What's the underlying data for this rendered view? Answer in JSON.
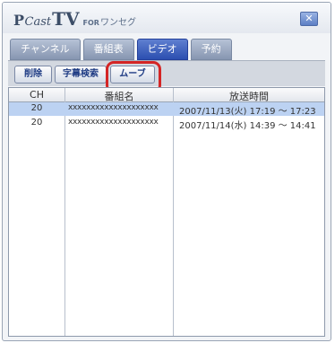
{
  "app": {
    "logo_p": "P",
    "logo_cast": "Cast",
    "logo_tv": "TV",
    "logo_for": "FOR",
    "logo_sub": "ワンセグ"
  },
  "window_buttons": {
    "close_icon": "close-icon",
    "close_glyph": "✕"
  },
  "tabs": [
    {
      "label": "チャンネル",
      "active": false
    },
    {
      "label": "番組表",
      "active": false
    },
    {
      "label": "ビデオ",
      "active": true
    },
    {
      "label": "予約",
      "active": false
    }
  ],
  "toolbar": {
    "delete_label": "削除",
    "subtitle_search_label": "字幕検索",
    "move_label": "ムーブ"
  },
  "table": {
    "headers": {
      "ch": "CH",
      "name": "番組名",
      "time": "放送時間"
    },
    "rows": [
      {
        "ch": "20",
        "name": "xxxxxxxxxxxxxxxxxxxx",
        "time": "2007/11/13(火) 17:19 ～ 17:23",
        "selected": true
      },
      {
        "ch": "20",
        "name": "xxxxxxxxxxxxxxxxxxxx",
        "time": "2007/11/14(水) 14:39 ～ 14:41",
        "selected": false
      }
    ]
  },
  "colors": {
    "active_tab": "#2c4fb0",
    "selected_row": "#bcd2f2",
    "highlight_ring": "#d42525"
  }
}
